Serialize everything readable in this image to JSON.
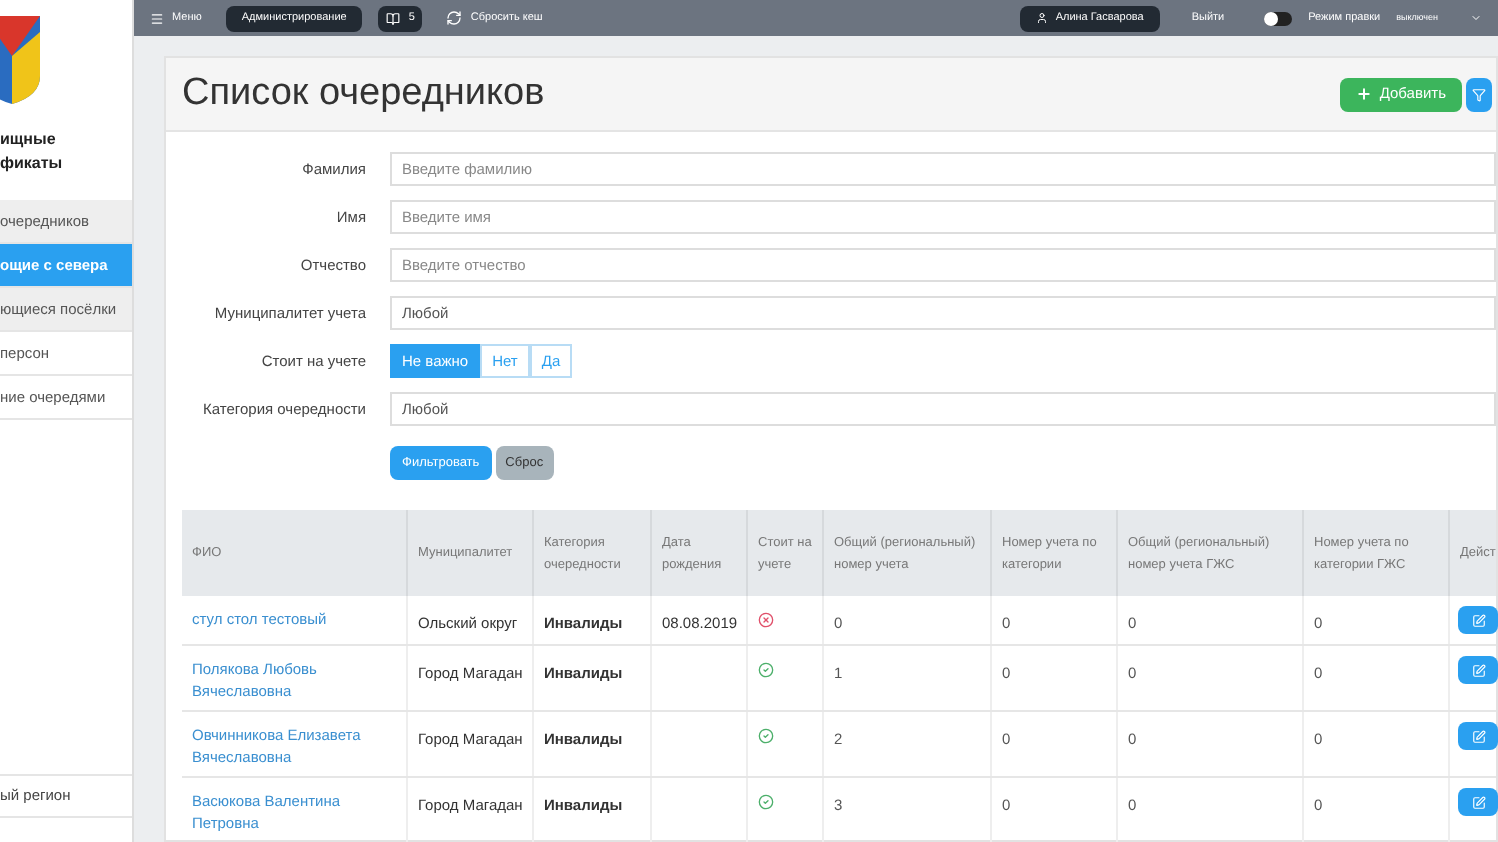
{
  "sidebar": {
    "title_lines": [
      "ищные",
      "фикаты"
    ],
    "items": [
      {
        "label": "очередников",
        "selected": false,
        "shaded": true
      },
      {
        "label": "ощие с севера",
        "selected": true,
        "shaded": false
      },
      {
        "label": "ющиеся посёлки",
        "selected": false,
        "shaded": true
      },
      {
        "label": "персон",
        "selected": false,
        "shaded": false
      },
      {
        "label": "ние очередями",
        "selected": false,
        "shaded": false
      }
    ],
    "footer_item": "ый регион"
  },
  "topbar": {
    "menu": "Меню",
    "admin": "Администрирование",
    "badge_count": "5",
    "reset_cache": "Сбросить кеш",
    "user": "Алина Гасварова",
    "logout": "Выйти",
    "edit_mode": {
      "label": "Режим правки",
      "status": "выключен",
      "on": false
    }
  },
  "page": {
    "title": "Список очередников",
    "add_button": "Добавить"
  },
  "filters": [
    {
      "kind": "text",
      "label": "Фамилия",
      "placeholder": "Введите фамилию"
    },
    {
      "kind": "text",
      "label": "Имя",
      "placeholder": "Введите имя"
    },
    {
      "kind": "text",
      "label": "Отчество",
      "placeholder": "Введите отчество"
    },
    {
      "kind": "select",
      "label": "Муниципалитет учета",
      "value": "Любой"
    },
    {
      "kind": "toggle",
      "label": "Стоит на учете",
      "options": [
        {
          "label": "Не важно",
          "selected": true
        },
        {
          "label": "Нет",
          "selected": false
        },
        {
          "label": "Да",
          "selected": false
        }
      ]
    },
    {
      "kind": "select",
      "label": "Категория очередности",
      "value": "Любой"
    }
  ],
  "filter_buttons": {
    "apply": "Фильтровать",
    "reset": "Сброс"
  },
  "table": {
    "columns": [
      "ФИО",
      "Муниципалитет",
      "Категория очередности",
      "Дата рождения",
      "Стоит на учете",
      "Общий (региональный) номер учета",
      "Номер учета по категории",
      "Общий (региональный) номер учета ГЖС",
      "Номер учета по категории ГЖС",
      "Дейст"
    ],
    "rows": [
      {
        "name": "стул стол тестовый",
        "municipality": "Ольский округ",
        "category": "Инвалиды",
        "birth_date": "08.08.2019",
        "registered": false,
        "general_number": "0",
        "category_number": "0",
        "general_gzhs": "0",
        "category_gzhs": "0"
      },
      {
        "name": "Полякова Любовь Вячеславовна",
        "municipality": "Город Магадан",
        "category": "Инвалиды",
        "registered": true,
        "general_number": "1",
        "category_number": "0",
        "general_gzhs": "0",
        "category_gzhs": "0"
      },
      {
        "name": "Овчинникова Елизавета Вячеславовна",
        "municipality": "Город Магадан",
        "category": "Инвалиды",
        "registered": true,
        "general_number": "2",
        "category_number": "0",
        "general_gzhs": "0",
        "category_gzhs": "0"
      },
      {
        "name": "Васюкова Валентина Петровна",
        "municipality": "Город Магадан",
        "category": "Инвалиды",
        "registered": true,
        "general_number": "3",
        "category_number": "0",
        "general_gzhs": "0",
        "category_gzhs": "0"
      }
    ]
  }
}
